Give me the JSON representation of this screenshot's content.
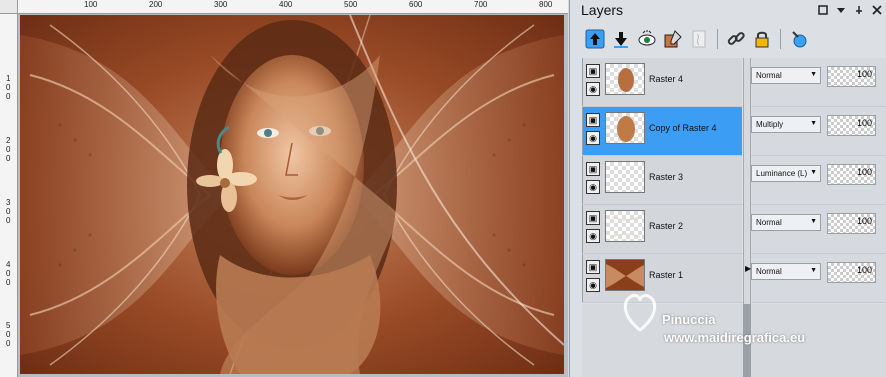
{
  "rulers": {
    "top_labels": [
      "100",
      "200",
      "300",
      "400",
      "500",
      "600",
      "700",
      "800"
    ],
    "left_labels": [
      "1 0 0",
      "2 0 0",
      "3 0 0",
      "4 0 0",
      "5 0 0"
    ]
  },
  "layers_panel": {
    "title": "Layers",
    "layers": [
      {
        "name": "Raster 4",
        "blend": "Normal",
        "opacity": "100",
        "selected": false
      },
      {
        "name": "Copy of Raster 4",
        "blend": "Multiply",
        "opacity": "100",
        "selected": true
      },
      {
        "name": "Raster 3",
        "blend": "Luminance (L)",
        "opacity": "100",
        "selected": false
      },
      {
        "name": "Raster 2",
        "blend": "Normal",
        "opacity": "100",
        "selected": false
      },
      {
        "name": "Raster 1",
        "blend": "Normal",
        "opacity": "100",
        "selected": false
      }
    ]
  },
  "watermark": {
    "name": "Pinuccia",
    "url": "www.maidiregrafica.eu"
  },
  "colors": {
    "selection": "#3c9df5",
    "image_bg": "#7a3a1d"
  },
  "icons": [
    "move-up-icon",
    "move-down-icon",
    "visibility-icon",
    "edit-icon",
    "mask-icon",
    "link-icon",
    "lock-icon",
    "properties-icon"
  ]
}
